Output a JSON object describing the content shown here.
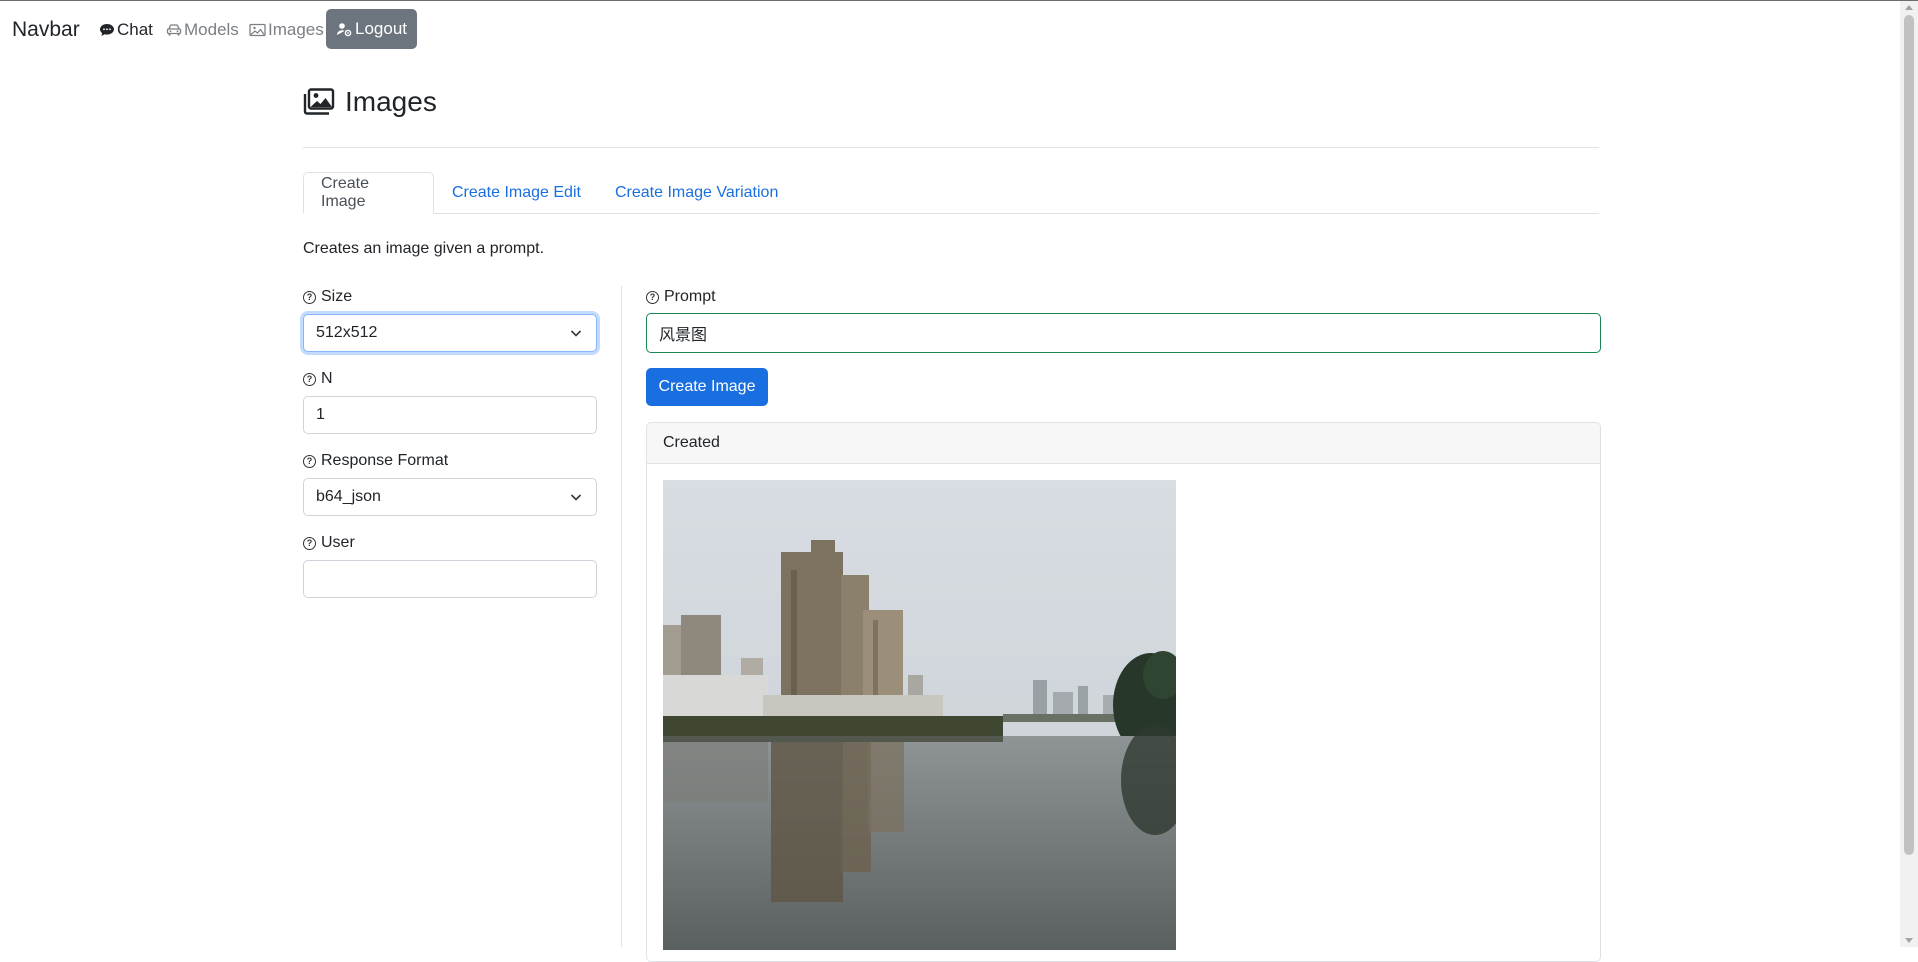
{
  "navbar": {
    "brand": "Navbar",
    "links": [
      {
        "label": "Chat",
        "icon": "chat-bubble-icon"
      },
      {
        "label": "Models",
        "icon": "car-icon"
      },
      {
        "label": "Images",
        "icon": "image-icon"
      }
    ],
    "logout_label": "Logout",
    "logout_icon": "person-gear-icon"
  },
  "page": {
    "title": "Images",
    "title_icon": "images-icon"
  },
  "tabs": [
    {
      "label": "Create Image",
      "active": true
    },
    {
      "label": "Create Image Edit",
      "active": false
    },
    {
      "label": "Create Image Variation",
      "active": false
    }
  ],
  "description": "Creates an image given a prompt.",
  "form": {
    "size": {
      "label": "Size",
      "value": "512x512"
    },
    "n": {
      "label": "N",
      "value": "1"
    },
    "response_format": {
      "label": "Response Format",
      "value": "b64_json"
    },
    "user": {
      "label": "User",
      "value": ""
    },
    "prompt": {
      "label": "Prompt",
      "value": "风景图"
    },
    "submit_label": "Create Image"
  },
  "result": {
    "header": "Created"
  },
  "colors": {
    "primary": "#1a6fe0",
    "secondary": "#6c757d",
    "success_border": "#198754",
    "focus_border": "#86b7fe"
  }
}
